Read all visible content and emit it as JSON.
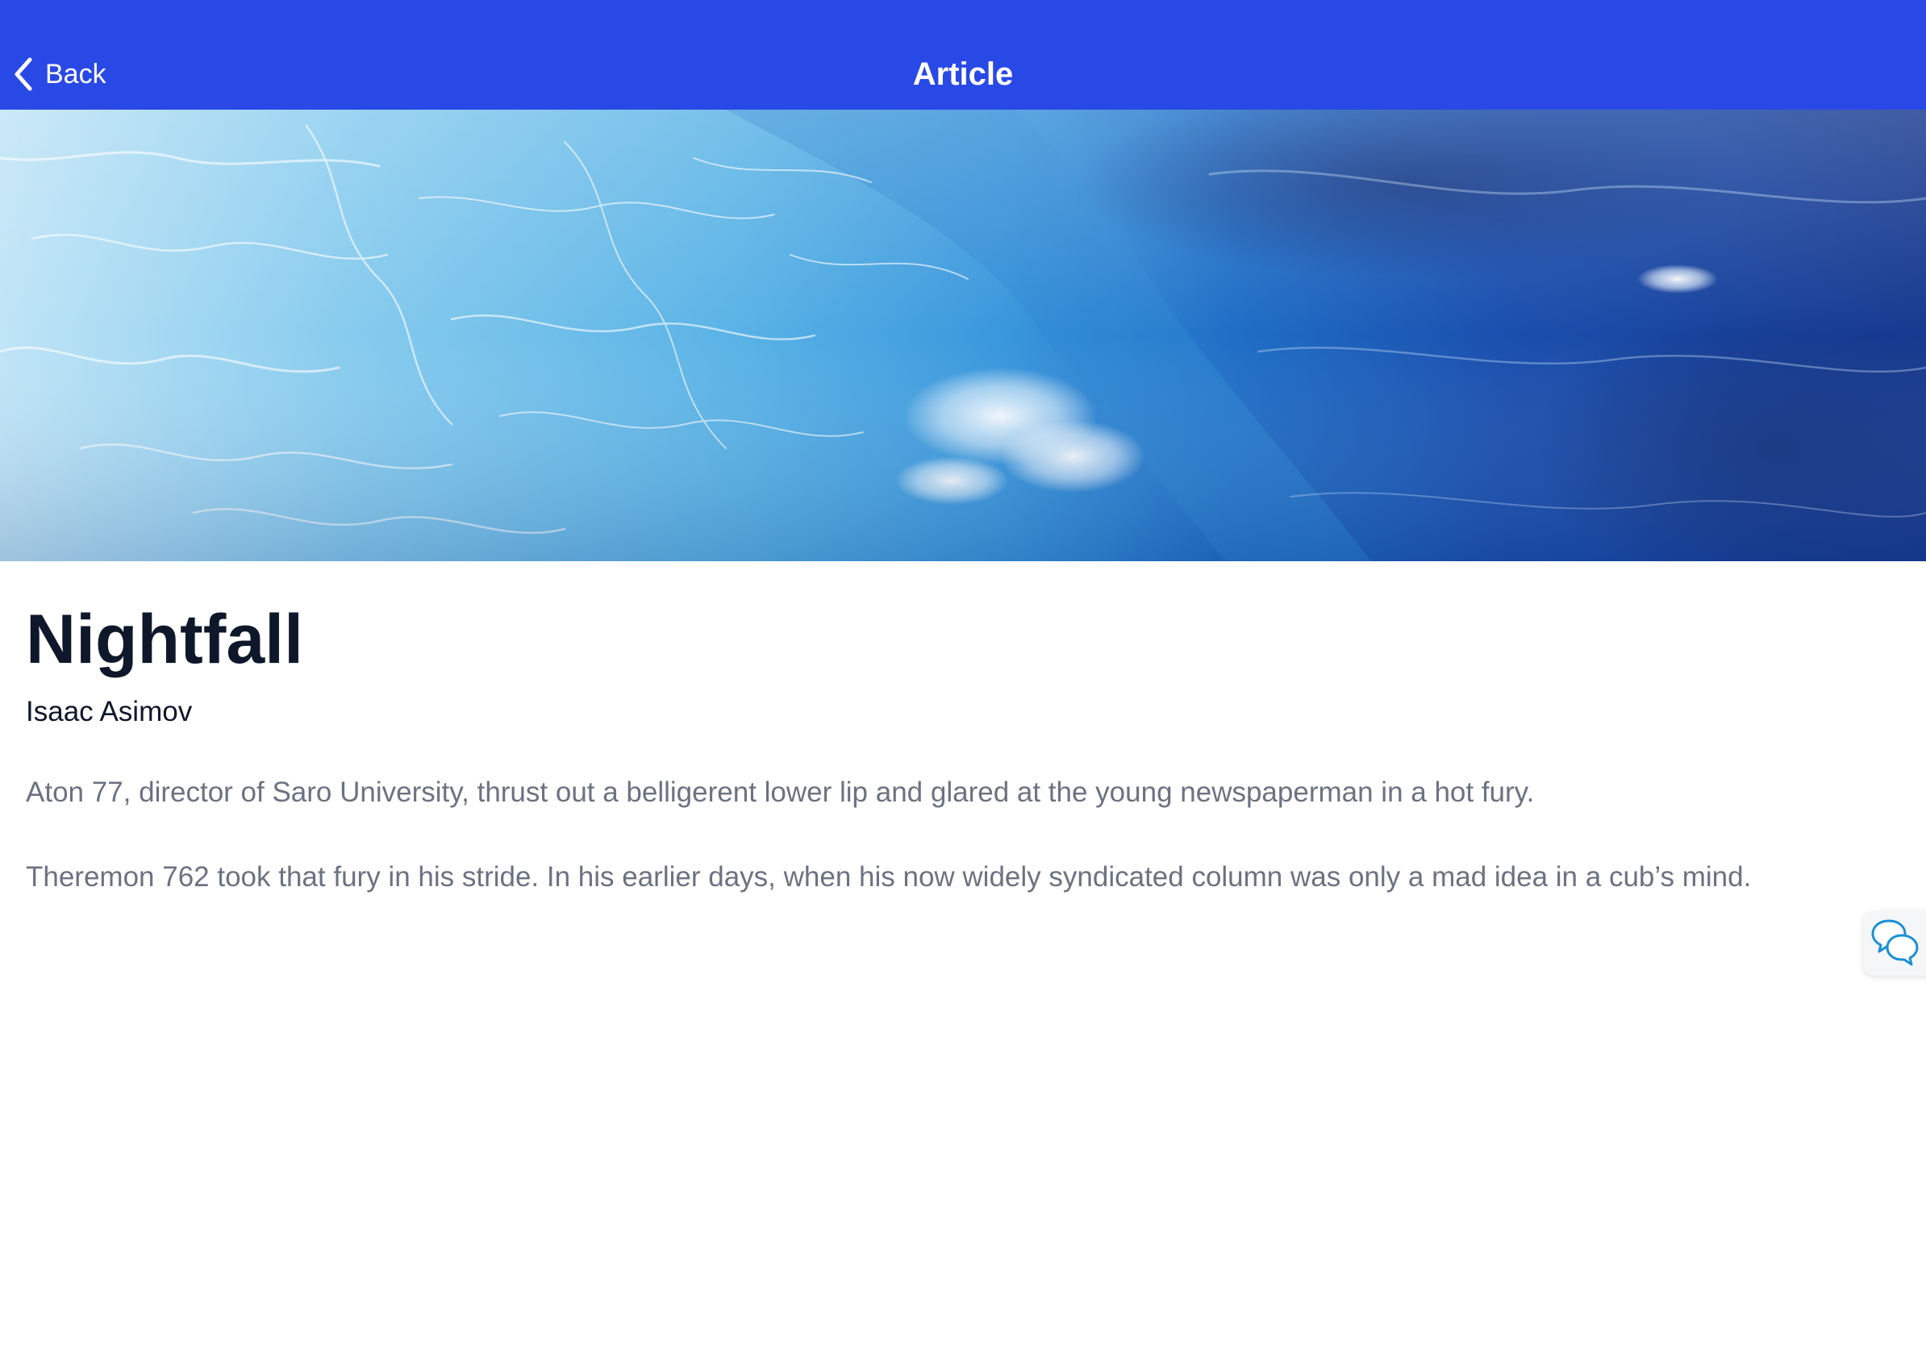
{
  "navbar": {
    "back_label": "Back",
    "title": "Article",
    "background_color": "#2949e6"
  },
  "hero": {
    "description_icon": "ocean-water-image"
  },
  "article": {
    "title": "Nightfall",
    "author": "Isaac Asimov",
    "paragraphs": [
      "Aton 77, director of Saro University, thrust out a belligerent lower lip and glared at the young newspaperman in a hot fury.",
      "Theremon 762 took that fury in his stride. In his earlier days, when his now widely syndicated column was only a mad idea in a cub’s mind."
    ]
  },
  "floating": {
    "chat_icon": "chat-bubbles-icon",
    "chat_icon_color": "#1b8fd6"
  }
}
